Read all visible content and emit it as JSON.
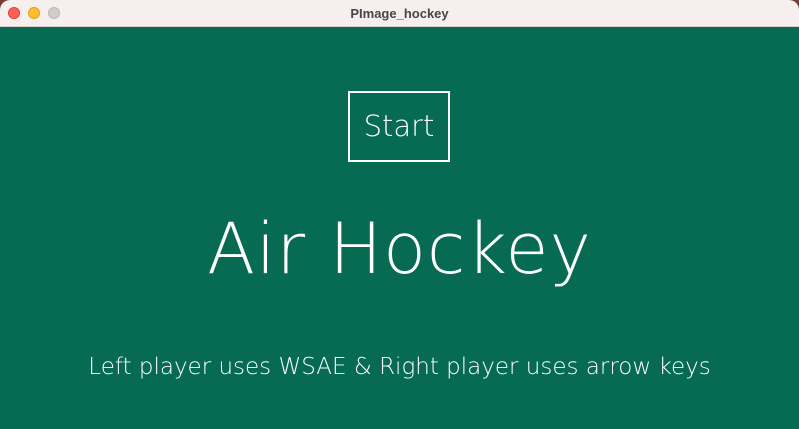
{
  "window": {
    "title": "PImage_hockey"
  },
  "colors": {
    "background": "#066b52",
    "foreground": "#ffffff",
    "titlebar": "#f7eeee",
    "close": "#fe5f57",
    "minimize": "#febc2e",
    "zoom": "#d0cccc"
  },
  "menu": {
    "start_label": "Start",
    "game_title": "Air Hockey",
    "instructions": "Left player uses WSAE & Right player uses arrow keys"
  }
}
